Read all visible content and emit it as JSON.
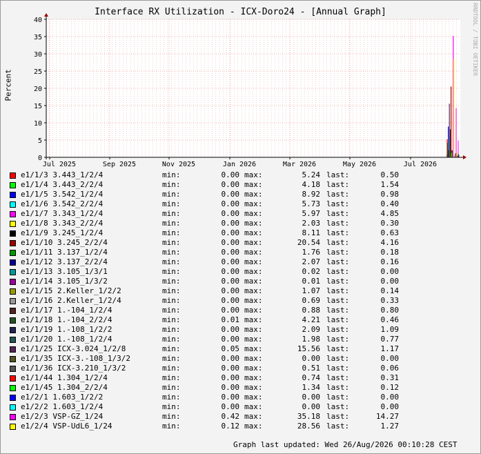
{
  "title": "Interface RX Utilization - ICX-Doro24 - [Annual Graph]",
  "watermark": "RRDTOOL / TOBI OETIKER",
  "updated": "Graph last updated: Wed 26/Aug/2026 00:10:28 CEST",
  "labels": {
    "min": "min:",
    "max": "max:",
    "last": "last:"
  },
  "chart_data": {
    "type": "line",
    "ylabel": "Percent",
    "ylim": [
      0,
      40
    ],
    "yticks": [
      "0",
      "5",
      "10",
      "15",
      "20",
      "25",
      "30",
      "35",
      "40"
    ],
    "xticks": [
      "Jul 2025",
      "Sep 2025",
      "Nov 2025",
      "Jan 2026",
      "Mar 2026",
      "May 2026",
      "Jul 2026"
    ],
    "grid": true,
    "colors": {
      "background": "#f3f3f3",
      "grid_major": "#e07070",
      "grid_minor": "#e0a0a0",
      "axis": "#000000",
      "arrow": "#990000"
    },
    "series": [
      {
        "name": "e1/1/3 3.443_1/2/4",
        "color": "#ff0000",
        "min": "0.00",
        "max": "5.24",
        "last": "0.50"
      },
      {
        "name": "e1/1/4 3.443_2/2/4",
        "color": "#00ff00",
        "min": "0.00",
        "max": "4.18",
        "last": "1.54"
      },
      {
        "name": "e1/1/5 3.542_1/2/4",
        "color": "#0000ff",
        "min": "0.00",
        "max": "8.92",
        "last": "0.98"
      },
      {
        "name": "e1/1/6 3.542_2/2/4",
        "color": "#00ffff",
        "min": "0.00",
        "max": "5.73",
        "last": "0.40"
      },
      {
        "name": "e1/1/7 3.343_1/2/4",
        "color": "#ff00ff",
        "min": "0.00",
        "max": "5.97",
        "last": "4.85"
      },
      {
        "name": "e1/1/8 3.343_2/2/4",
        "color": "#ffff00",
        "min": "0.00",
        "max": "2.03",
        "last": "0.30"
      },
      {
        "name": "e1/1/9 3.245_1/2/4",
        "color": "#000000",
        "min": "0.00",
        "max": "8.11",
        "last": "0.63"
      },
      {
        "name": "e1/1/10 3.245_2/2/4",
        "color": "#990000",
        "min": "0.00",
        "max": "20.54",
        "last": "4.16"
      },
      {
        "name": "e1/1/11 3.137_1/2/4",
        "color": "#009900",
        "min": "0.00",
        "max": "1.76",
        "last": "0.18"
      },
      {
        "name": "e1/1/12 3.137_2/2/4",
        "color": "#000099",
        "min": "0.00",
        "max": "2.07",
        "last": "0.16"
      },
      {
        "name": "e1/1/13 3.105_1/3/1",
        "color": "#009999",
        "min": "0.00",
        "max": "0.02",
        "last": "0.00"
      },
      {
        "name": "e1/1/14 3.105_1/3/2",
        "color": "#990099",
        "min": "0.00",
        "max": "0.01",
        "last": "0.00"
      },
      {
        "name": "e1/1/15 2.Keller_1/2/2",
        "color": "#999900",
        "min": "0.00",
        "max": "1.07",
        "last": "0.14"
      },
      {
        "name": "e1/1/16 2.Keller_1/2/4",
        "color": "#999999",
        "min": "0.00",
        "max": "0.69",
        "last": "0.33"
      },
      {
        "name": "e1/1/17 1.-104_1/2/4",
        "color": "#552222",
        "min": "0.00",
        "max": "0.88",
        "last": "0.80"
      },
      {
        "name": "e1/1/18 1.-104_2/2/4",
        "color": "#225522",
        "min": "0.01",
        "max": "4.21",
        "last": "0.46"
      },
      {
        "name": "e1/1/19 1.-108_1/2/2",
        "color": "#222255",
        "min": "0.00",
        "max": "2.09",
        "last": "1.09"
      },
      {
        "name": "e1/1/20 1.-108_1/2/4",
        "color": "#225555",
        "min": "0.00",
        "max": "1.98",
        "last": "0.77"
      },
      {
        "name": "e1/1/25 ICX-3.024_1/2/8",
        "color": "#552255",
        "min": "0.05",
        "max": "15.56",
        "last": "1.17"
      },
      {
        "name": "e1/1/35 ICX-3.-108_1/3/2",
        "color": "#555522",
        "min": "0.00",
        "max": "0.00",
        "last": "0.00"
      },
      {
        "name": "e1/1/36 ICX-3.210_1/3/2",
        "color": "#555555",
        "min": "0.00",
        "max": "0.51",
        "last": "0.06"
      },
      {
        "name": "e1/1/44 1.304_1/2/4",
        "color": "#ff0000",
        "min": "0.00",
        "max": "0.74",
        "last": "0.31"
      },
      {
        "name": "e1/1/45 1.304_2/2/4",
        "color": "#00ff00",
        "min": "0.00",
        "max": "1.34",
        "last": "0.12"
      },
      {
        "name": "e1/2/1 1.603_1/2/2",
        "color": "#0000ff",
        "min": "0.00",
        "max": "0.00",
        "last": "0.00"
      },
      {
        "name": "e1/2/2 1.603_1/2/4",
        "color": "#00ffff",
        "min": "0.00",
        "max": "0.00",
        "last": "0.00"
      },
      {
        "name": "e1/2/3 VSP-GZ_1/24",
        "color": "#ff00ff",
        "min": "0.42",
        "max": "35.18",
        "last": "14.27"
      },
      {
        "name": "e1/2/4 VSP-UdL6_1/24",
        "color": "#ffff00",
        "min": "0.12",
        "max": "28.56",
        "last": "1.27"
      }
    ]
  }
}
